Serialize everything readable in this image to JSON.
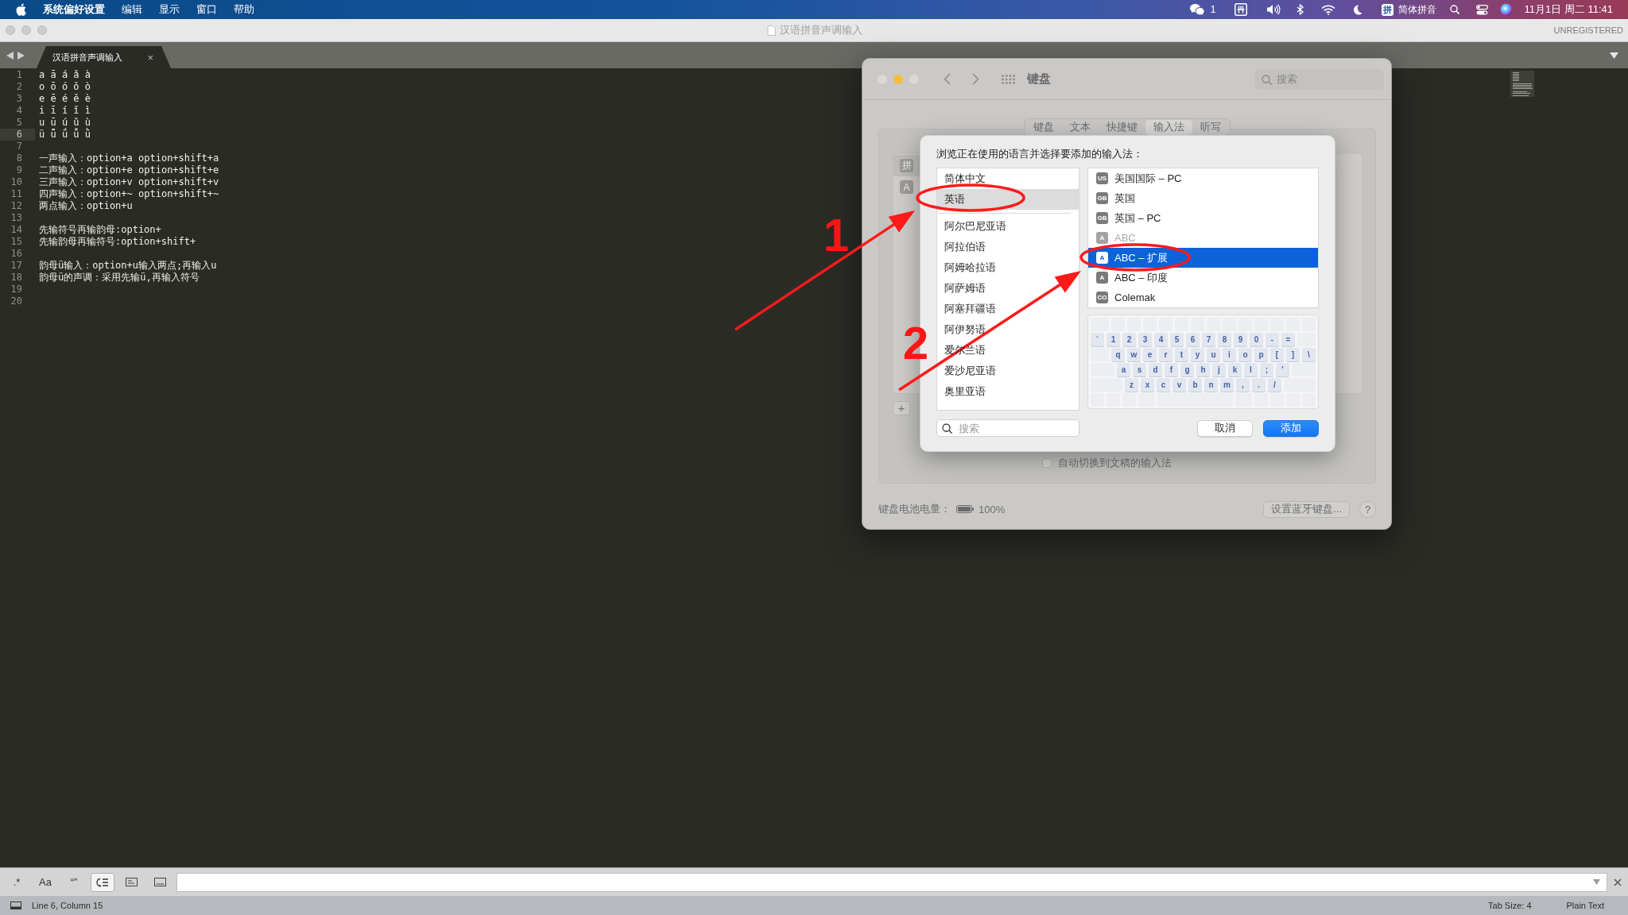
{
  "menu_bar": {
    "app_name": "系统偏好设置",
    "menus": [
      "编辑",
      "显示",
      "窗口",
      "帮助"
    ],
    "chat_count": "1",
    "input_badge": "拼",
    "input_method": "简体拼音",
    "clock": "11月1日 周二 11:41"
  },
  "editor": {
    "title": "汉语拼音声调输入",
    "license": "UNREGISTERED",
    "tabs": [
      {
        "label": "汉语拼音声调输入",
        "close": "×",
        "selected": true
      }
    ],
    "lines": [
      {
        "number": "1",
        "text": "a ā á ǎ à",
        "current": false
      },
      {
        "number": "2",
        "text": "o ō ó ǒ ò",
        "current": false
      },
      {
        "number": "3",
        "text": "e ē é ě è",
        "current": false
      },
      {
        "number": "4",
        "text": "i ī í ǐ ì",
        "current": false
      },
      {
        "number": "5",
        "text": "u ū ú ǔ ù",
        "current": false
      },
      {
        "number": "6",
        "text": "ü ǖ ǘ ǚ ǜ",
        "current": true
      },
      {
        "number": "7",
        "current": false
      },
      {
        "number": "8",
        "text": "一声输入：option+a option+shift+a",
        "current": false
      },
      {
        "number": "9",
        "text": "二声输入：option+e option+shift+e",
        "current": false
      },
      {
        "number": "10",
        "text": "三声输入：option+v option+shift+v",
        "current": false
      },
      {
        "number": "11",
        "text": "四声输入：option+~ option+shift+~",
        "current": false
      },
      {
        "number": "12",
        "text": "两点输入：option+u",
        "current": false
      },
      {
        "number": "13",
        "current": false
      },
      {
        "number": "14",
        "text": "先输符号再输韵母:option+",
        "current": false
      },
      {
        "number": "15",
        "text": "先输韵母再输符号:option+shift+",
        "current": false
      },
      {
        "number": "16",
        "current": false
      },
      {
        "number": "17",
        "text": "韵母ü输入：option+u输入两点;再输入u",
        "current": false
      },
      {
        "number": "18",
        "text": "韵母ü的声调：采用先输ü,再输入符号",
        "current": false
      },
      {
        "number": "19",
        "current": false
      },
      {
        "number": "20",
        "current": false
      }
    ]
  },
  "find_bar": {
    "toggles": [
      {
        "kind": "text",
        "label": ".*",
        "on": false
      },
      {
        "kind": "text",
        "label": "Aa",
        "on": false
      },
      {
        "kind": "text",
        "label": "“”",
        "on": false
      },
      {
        "kind": "wrap",
        "on": true
      },
      {
        "kind": "in-selection",
        "on": false
      },
      {
        "kind": "highlight",
        "on": false
      }
    ]
  },
  "status_bar": {
    "position": "Line 6, Column 15",
    "tab_size": "Tab Size: 4",
    "syntax": "Plain Text"
  },
  "keyboard_prefs": {
    "title": "键盘",
    "search_placeholder": "搜索",
    "tabs": [
      {
        "label": "键盘",
        "selected": false
      },
      {
        "label": "文本",
        "selected": false
      },
      {
        "label": "快捷键",
        "selected": false
      },
      {
        "label": "输入法",
        "selected": true
      },
      {
        "label": "听写",
        "selected": false
      }
    ],
    "input_sources": [
      {
        "badge": "拼",
        "selected": true
      },
      {
        "badge": "A",
        "selected": false
      }
    ],
    "add_button": "+",
    "auto_switch": {
      "label": "自动切换到文稿的输入法",
      "checked": false
    },
    "battery_label": "键盘电池电量：",
    "battery_reading": "100%",
    "bluetooth_button": "设置蓝牙键盘...",
    "help_button": "?"
  },
  "add_sheet": {
    "prompt": "浏览正在使用的语言并选择要添加的输入法：",
    "preferred_languages": [
      {
        "label": "简体中文",
        "selected": false
      },
      {
        "label": "英语",
        "selected": true
      }
    ],
    "other_languages": [
      {
        "label": "阿尔巴尼亚语",
        "selected": false
      },
      {
        "label": "阿拉伯语",
        "selected": false
      },
      {
        "label": "阿姆哈拉语",
        "selected": false
      },
      {
        "label": "阿萨姆语",
        "selected": false
      },
      {
        "label": "阿塞拜疆语",
        "selected": false
      },
      {
        "label": "阿伊努语",
        "selected": false
      },
      {
        "label": "爱尔兰语",
        "selected": false
      },
      {
        "label": "爱沙尼亚语",
        "selected": false
      },
      {
        "label": "奥里亚语",
        "selected": false
      }
    ],
    "layouts": [
      {
        "badge": "US",
        "label": "美国国际 – PC",
        "selected": false,
        "disabled": false
      },
      {
        "badge": "GB",
        "label": "英国",
        "selected": false,
        "disabled": false
      },
      {
        "badge": "GB",
        "label": "英国 – PC",
        "selected": false,
        "disabled": false
      },
      {
        "badge": "A",
        "label": "ABC",
        "selected": false,
        "disabled": true
      },
      {
        "badge": "A",
        "label": "ABC – 扩展",
        "selected": true,
        "disabled": false
      },
      {
        "badge": "A",
        "label": "ABC – 印度",
        "selected": false,
        "disabled": false
      },
      {
        "badge": "CO",
        "label": "Colemak",
        "selected": false,
        "disabled": false
      }
    ],
    "keyboard_rows": [
      [
        "`",
        "1",
        "2",
        "3",
        "4",
        "5",
        "6",
        "7",
        "8",
        "9",
        "0",
        "-",
        "="
      ],
      [
        "q",
        "w",
        "e",
        "r",
        "t",
        "y",
        "u",
        "i",
        "o",
        "p",
        "[",
        "]",
        "\\"
      ],
      [
        "a",
        "s",
        "d",
        "f",
        "g",
        "h",
        "j",
        "k",
        "l",
        ";",
        "'"
      ],
      [
        "z",
        "x",
        "c",
        "v",
        "b",
        "n",
        "m",
        ",",
        ".",
        "/"
      ]
    ],
    "search_placeholder": "搜索",
    "buttons": [
      {
        "label": "取消",
        "kind": "secondary"
      },
      {
        "label": "添加",
        "kind": "primary"
      }
    ]
  },
  "annotations": [
    "1",
    "2"
  ]
}
